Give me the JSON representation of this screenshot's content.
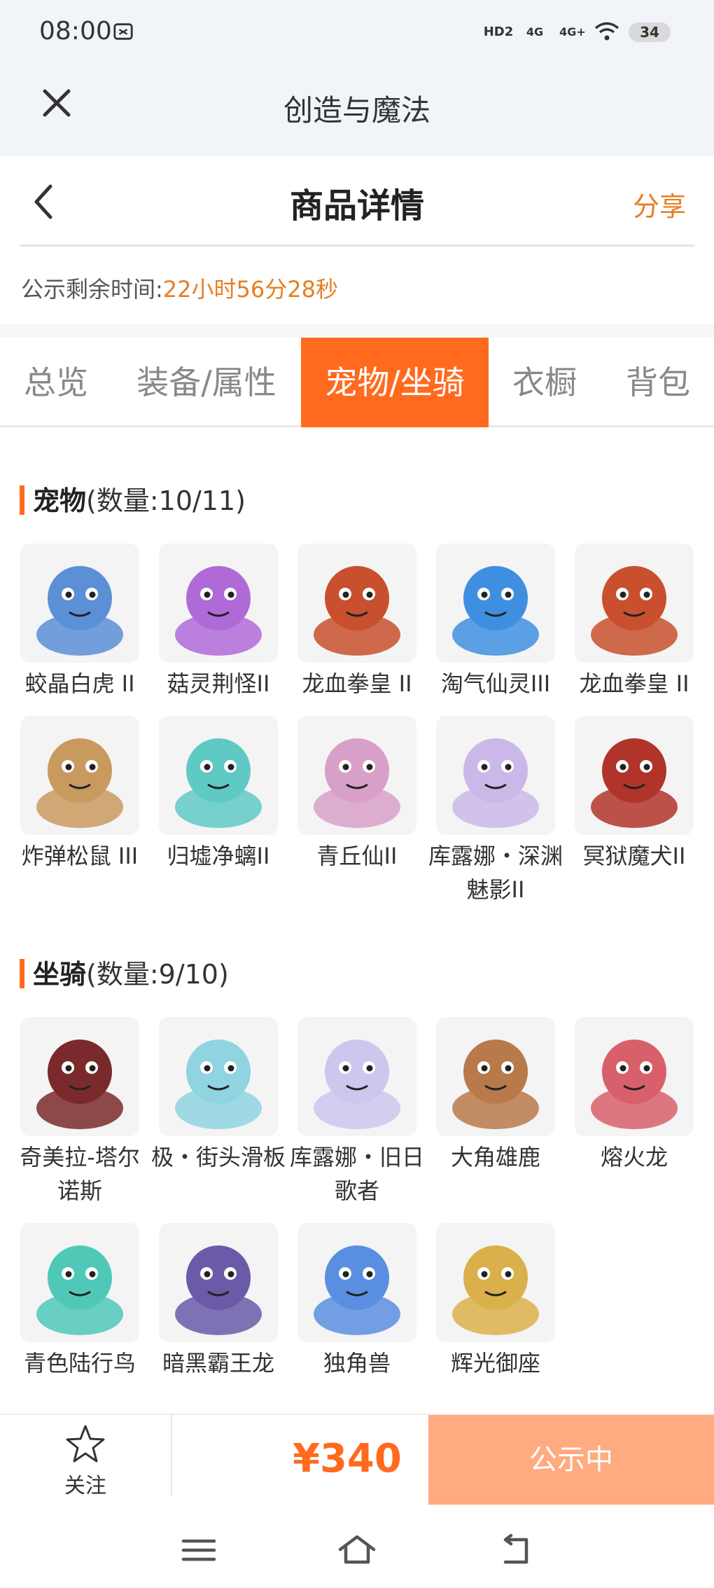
{
  "status_bar": {
    "time": "08:00",
    "battery": "34",
    "net1": "HD2",
    "net2": "4G",
    "net3": "4G+"
  },
  "app_bar": {
    "title": "创造与魔法"
  },
  "header": {
    "title": "商品详情",
    "share": "分享"
  },
  "notice": {
    "label": "公示剩余时间:",
    "remain": "22小时56分28秒"
  },
  "tabs": [
    "总览",
    "装备/属性",
    "宠物/坐骑",
    "衣橱",
    "背包"
  ],
  "active_tab": "宠物/坐骑",
  "pets": {
    "title": "宠物",
    "count": "(数量:10/11)",
    "items": [
      {
        "name": "蛟晶白虎 II",
        "color": "#5b8fd6"
      },
      {
        "name": "菇灵荆怪II",
        "color": "#b06ad8"
      },
      {
        "name": "龙血拳皇 II",
        "color": "#c8502e"
      },
      {
        "name": "淘气仙灵III",
        "color": "#3f8fe0"
      },
      {
        "name": "龙血拳皇 II",
        "color": "#c8502e"
      },
      {
        "name": "炸弹松鼠 III",
        "color": "#c89a5e"
      },
      {
        "name": "归墟净螭II",
        "color": "#5fc9c4"
      },
      {
        "name": "青丘仙II",
        "color": "#d8a0c8"
      },
      {
        "name": "库露娜・深渊魅影II",
        "color": "#c9b8e8"
      },
      {
        "name": "冥狱魔犬II",
        "color": "#b0342a"
      }
    ]
  },
  "mounts": {
    "title": "坐骑",
    "count": "(数量:9/10)",
    "items": [
      {
        "name": "奇美拉-塔尔诺斯",
        "color": "#7a2a2a"
      },
      {
        "name": "极・街头滑板",
        "color": "#8fd4e0"
      },
      {
        "name": "库露娜・旧日歌者",
        "color": "#cfc6ee"
      },
      {
        "name": "大角雄鹿",
        "color": "#b87a4a"
      },
      {
        "name": "熔火龙",
        "color": "#d8606a"
      },
      {
        "name": "青色陆行鸟",
        "color": "#4fc8b8"
      },
      {
        "name": "暗黑霸王龙",
        "color": "#6a5aa8"
      },
      {
        "name": "独角兽",
        "color": "#5a8ee0"
      },
      {
        "name": "辉光御座",
        "color": "#d9b04a"
      }
    ]
  },
  "bottom": {
    "follow": "关注",
    "price": "¥340",
    "status": "公示中"
  },
  "colors": {
    "accent": "#ff6a1f",
    "accent_light": "#ffaa80",
    "link": "#e67e22"
  }
}
